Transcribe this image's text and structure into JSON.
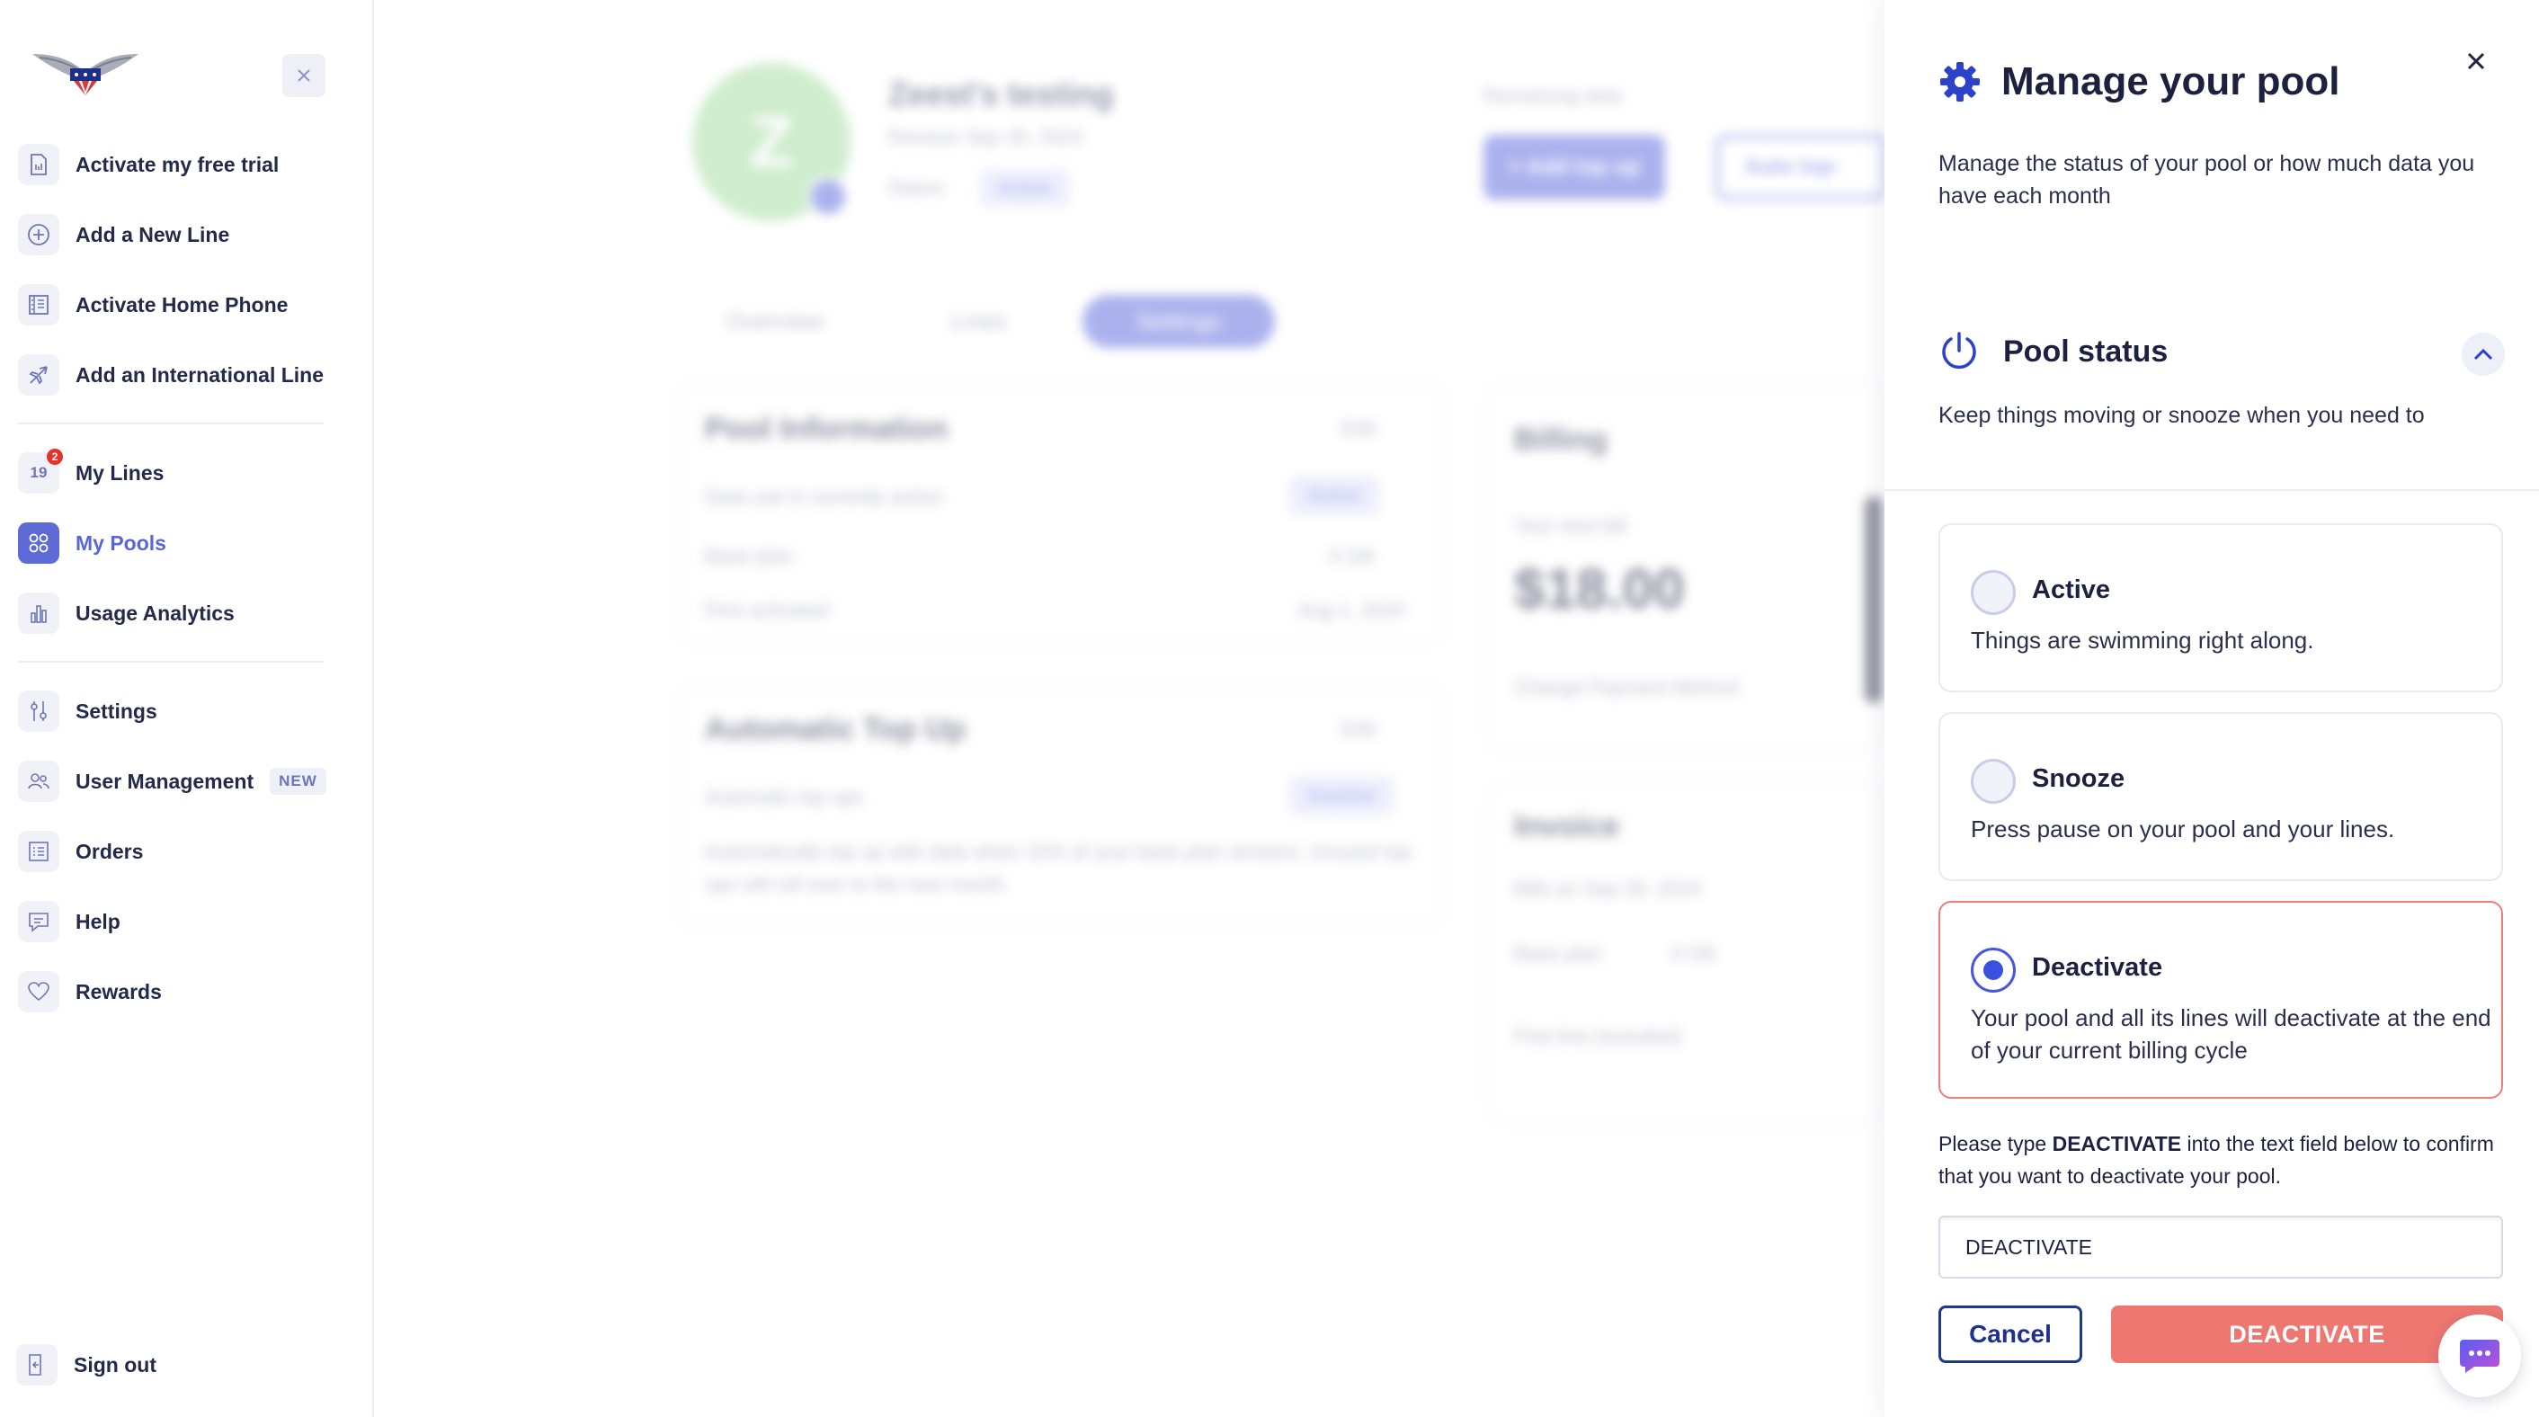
{
  "sidebar": {
    "collapse_icon": "close-icon",
    "items": [
      {
        "label": "Activate my free trial",
        "icon": "sim-card-icon"
      },
      {
        "label": "Add a New Line",
        "icon": "plus-circle-icon"
      },
      {
        "label": "Activate Home Phone",
        "icon": "building-icon"
      },
      {
        "label": "Add an International Line",
        "icon": "airplane-icon"
      },
      {
        "label": "My Lines",
        "icon": "lines-icon",
        "number": "19",
        "badge": "2"
      },
      {
        "label": "My Pools",
        "icon": "grid-icon",
        "active": true
      },
      {
        "label": "Usage Analytics",
        "icon": "bar-chart-icon"
      },
      {
        "label": "Settings",
        "icon": "settings-sliders-icon"
      },
      {
        "label": "User Management",
        "icon": "users-icon",
        "tag": "NEW"
      },
      {
        "label": "Orders",
        "icon": "list-icon"
      },
      {
        "label": "Help",
        "icon": "chat-icon"
      },
      {
        "label": "Rewards",
        "icon": "heart-icon"
      }
    ],
    "sign_out": "Sign out"
  },
  "background": {
    "avatar_letter": "Z",
    "pool_name": "Zeest's testing",
    "renews": "Renews Sep 30, 2024",
    "status_label": "Status",
    "status_value": "Active",
    "remaining_data": "Remaining data",
    "add_top_up": "+ Add top up",
    "auto_top_up": "Auto top-",
    "tabs": [
      "Overview",
      "Lines",
      "Settings"
    ],
    "pool_info_title": "Pool Information",
    "edit": "Edit",
    "pool_info_rows": [
      {
        "label": "Data use is currently active",
        "value": "Active"
      },
      {
        "label": "Base plan",
        "value": "4 GB"
      },
      {
        "label": "First activated",
        "value": "Aug 1, 2024"
      }
    ],
    "auto_top_up_title": "Automatic Top Up",
    "auto_top_ups_label": "Automatic top ups",
    "auto_top_ups_value": "Inactive",
    "auto_top_up_desc": "Automatically top up with data when 10% of your base plan remains. Unused top ups will roll over to the next month.",
    "billing_title": "Billing",
    "next_bill_label": "Your next bill",
    "next_bill_amount": "$18.00",
    "change_payment": "Change Payment Method",
    "invoice_title": "Invoice",
    "bills_on": "Bills on Sep 30, 2024",
    "invoice_base_plan": "Base plan",
    "invoice_base_value": "4 GB",
    "first_line": "First line (included)"
  },
  "drawer": {
    "title": "Manage your pool",
    "subtitle": "Manage the status of your pool or how much data you have each month",
    "section_title": "Pool status",
    "section_subtitle": "Keep things moving or snooze when you need to",
    "options": [
      {
        "title": "Active",
        "desc": "Things are swimming right along.",
        "selected": false
      },
      {
        "title": "Snooze",
        "desc": "Press pause on your pool and your lines.",
        "selected": false
      },
      {
        "title": "Deactivate",
        "desc": "Your pool and all its lines will deactivate at the end of your current billing cycle",
        "selected": true
      }
    ],
    "confirm_prefix": "Please type ",
    "confirm_keyword": "DEACTIVATE",
    "confirm_suffix": " into the text field below to confirm that you want to deactivate your pool.",
    "input_value": "DEACTIVATE",
    "cancel_label": "Cancel",
    "deactivate_label": "DEACTIVATE"
  },
  "colors": {
    "accent": "#5e6ad6",
    "danger": "#ee7771",
    "radio_checked": "#3b50de",
    "cancel_border": "#23368f"
  }
}
